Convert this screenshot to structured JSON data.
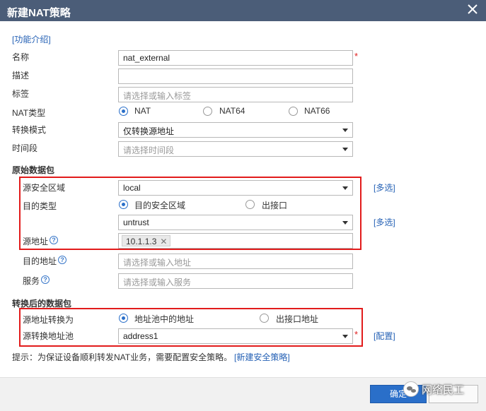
{
  "window": {
    "title": "新建NAT策略"
  },
  "intro_link": "[功能介绍]",
  "form": {
    "name": {
      "label": "名称",
      "value": "nat_external"
    },
    "description": {
      "label": "描述",
      "value": ""
    },
    "tag": {
      "label": "标签",
      "placeholder": "请选择或输入标签"
    },
    "nat_type": {
      "label": "NAT类型",
      "options": [
        "NAT",
        "NAT64",
        "NAT66"
      ],
      "selected": "NAT"
    },
    "convert_mode": {
      "label": "转换模式",
      "value": "仅转换源地址"
    },
    "time_range": {
      "label": "时间段",
      "placeholder": "请选择时间段"
    }
  },
  "original_packet": {
    "heading": "原始数据包",
    "src_zone": {
      "label": "源安全区域",
      "value": "local",
      "multi_link": "[多选]"
    },
    "dst_type": {
      "label": "目的类型",
      "options": [
        "目的安全区域",
        "出接口"
      ],
      "selected": "目的安全区域",
      "value": "untrust",
      "multi_link": "[多选]"
    },
    "src_addr": {
      "label": "源地址",
      "tags": [
        "10.1.1.3"
      ]
    },
    "dst_addr": {
      "label": "目的地址",
      "placeholder": "请选择或输入地址"
    },
    "service": {
      "label": "服务",
      "placeholder": "请选择或输入服务"
    }
  },
  "translated_packet": {
    "heading": "转换后的数据包",
    "src_translate": {
      "label": "源地址转换为",
      "options": [
        "地址池中的地址",
        "出接口地址"
      ],
      "selected": "地址池中的地址"
    },
    "pool": {
      "label": "源转换地址池",
      "value": "address1",
      "config_link": "[配置]"
    }
  },
  "hint": {
    "text": "提示：为保证设备顺利转发NAT业务，需要配置安全策略。",
    "link": "[新建安全策略]"
  },
  "footer": {
    "ok_label": "确定"
  },
  "watermark": {
    "text": "网络民工"
  },
  "colors": {
    "titlebar": "#4b5d78",
    "highlight_box": "#e21b1b",
    "link": "#2561b5",
    "primary_button": "#2a6fc9"
  }
}
